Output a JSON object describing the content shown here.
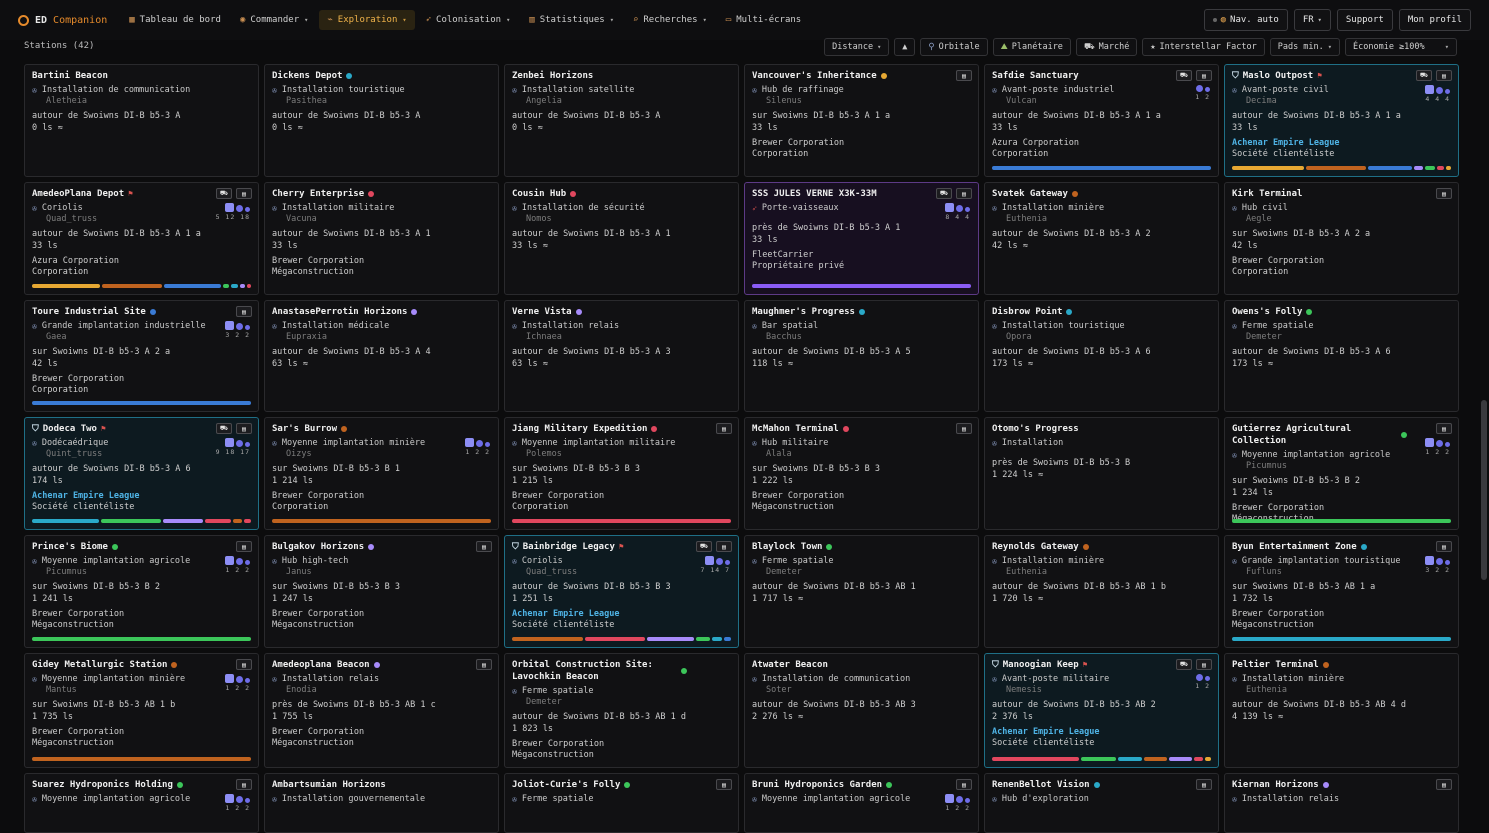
{
  "nav": {
    "brand_ed": "ED",
    "brand_companion": "Companion",
    "items": [
      {
        "label": "Tableau de bord",
        "icon": "dashboard-icon",
        "glyph": "▦",
        "caret": false,
        "active": false
      },
      {
        "label": "Commander",
        "icon": "commander-icon",
        "glyph": "◉",
        "caret": true,
        "active": false
      },
      {
        "label": "Exploration",
        "icon": "telescope-icon",
        "glyph": "⌁",
        "caret": true,
        "active": true
      },
      {
        "label": "Colonisation",
        "icon": "rocket-icon",
        "glyph": "➶",
        "caret": true,
        "active": false
      },
      {
        "label": "Statistiques",
        "icon": "chart-icon",
        "glyph": "▥",
        "caret": true,
        "active": false
      },
      {
        "label": "Recherches",
        "icon": "search-icon",
        "glyph": "⌕",
        "caret": true,
        "active": false
      },
      {
        "label": "Multi-écrans",
        "icon": "monitor-icon",
        "glyph": "▭",
        "caret": false,
        "active": false
      }
    ],
    "nav_auto": "Nav. auto",
    "lang": "FR",
    "support": "Support",
    "profile": "Mon profil"
  },
  "toolbar": {
    "count": "Stations (42)",
    "distance": "Distance",
    "orbitale": "Orbitale",
    "planetaire": "Planétaire",
    "marche": "Marché",
    "interstellar": "Interstellar Factor",
    "pads": "Pads min.",
    "economie": "Économie ≥100%"
  },
  "colors": {
    "orange": "#c0631f",
    "blue": "#3a7bd5",
    "cyan": "#2aa9c8",
    "red": "#e0475e",
    "purple": "#a78bfa",
    "green": "#3cc65a",
    "gold": "#e6a833",
    "violet": "#8b5cf6"
  },
  "stations": [
    {
      "name": "Bartini Beacon",
      "dot": null,
      "type": "Installation de communication",
      "eco": "Aletheia",
      "orbit": "autour de Swoiwns DI-B b5-3 A",
      "dist": "0 ls ≈",
      "fac": "",
      "gov": "",
      "icons": [],
      "pads": null,
      "bar": [],
      "style": ""
    },
    {
      "name": "Dickens Depot",
      "dot": "cyan",
      "type": "Installation touristique",
      "eco": "Pasithea",
      "orbit": "autour de Swoiwns DI-B b5-3 A",
      "dist": "0 ls ≈",
      "fac": "",
      "gov": "",
      "icons": [],
      "pads": null,
      "bar": [],
      "style": ""
    },
    {
      "name": "Zenbei Horizons",
      "dot": null,
      "type": "Installation satellite",
      "eco": "Angelia",
      "orbit": "autour de Swoiwns DI-B b5-3 A",
      "dist": "0 ls ≈",
      "fac": "",
      "gov": "",
      "icons": [],
      "pads": null,
      "bar": [],
      "style": ""
    },
    {
      "name": "Vancouver's Inheritance",
      "dot": "gold",
      "type": "Hub de raffinage",
      "eco": "Silenus",
      "orbit": "sur Swoiwns DI-B b5-3 A 1 a",
      "dist": "33 ls",
      "fac": "Brewer Corporation",
      "gov": "Corporation",
      "icons": [
        "doc"
      ],
      "pads": null,
      "bar": [],
      "style": ""
    },
    {
      "name": "Safdie Sanctuary",
      "dot": null,
      "type": "Avant-poste industriel",
      "eco": "Vulcan",
      "orbit": "autour de Swoiwns DI-B b5-3 A 1 a",
      "dist": "33 ls",
      "fac": "Azura Corporation",
      "gov": "Corporation",
      "icons": [
        "flag",
        "doc"
      ],
      "pads": "12",
      "bar": [
        [
          "blue",
          1
        ]
      ],
      "style": ""
    },
    {
      "name": "Maslo Outpost",
      "dot": null,
      "type": "Avant-poste civil",
      "eco": "Decima",
      "orbit": "autour de Swoiwns DI-B b5-3 A 1 a",
      "dist": "33 ls",
      "fac": "Achenar Empire League",
      "gov": "Société clientéliste",
      "icons": [
        "flag",
        "doc"
      ],
      "pads": "444",
      "bar": [
        [
          "gold",
          3
        ],
        [
          "orange",
          2.5
        ],
        [
          "blue",
          1.8
        ],
        [
          "purple",
          0.4
        ],
        [
          "green",
          0.4
        ],
        [
          "red",
          0.3
        ],
        [
          "gold",
          0.2
        ]
      ],
      "style": "hl"
    },
    {
      "name": "AmedeoPlana Depot",
      "dot": null,
      "type": "Coriolis",
      "eco": "Quad_truss",
      "orbit": "autour de Swoiwns DI-B b5-3 A 1 a",
      "dist": "33 ls",
      "fac": "Azura Corporation",
      "gov": "Corporation",
      "icons": [
        "flag",
        "doc"
      ],
      "pads": "51218",
      "bar": [
        [
          "gold",
          3
        ],
        [
          "orange",
          2.7
        ],
        [
          "blue",
          2.5
        ],
        [
          "green",
          0.3
        ],
        [
          "cyan",
          0.3
        ],
        [
          "purple",
          0.2
        ],
        [
          "red",
          0.2
        ]
      ],
      "style": ""
    },
    {
      "name": "Cherry Enterprise",
      "dot": "red",
      "type": "Installation militaire",
      "eco": "Vacuna",
      "orbit": "autour de Swoiwns DI-B b5-3 A 1",
      "dist": "33 ls",
      "fac": "Brewer Corporation",
      "gov": "Mégaconstruction",
      "icons": [],
      "pads": null,
      "bar": [],
      "style": ""
    },
    {
      "name": "Cousin Hub",
      "dot": "red",
      "type": "Installation de sécurité",
      "eco": "Nomos",
      "orbit": "autour de Swoiwns DI-B b5-3 A 1",
      "dist": "33 ls ≈",
      "fac": "",
      "gov": "",
      "icons": [],
      "pads": null,
      "bar": [],
      "style": ""
    },
    {
      "name": "SSS JULES VERNE X3K-33M",
      "dot": null,
      "type": "Porte-vaisseaux",
      "eco": "",
      "orbit": "près de Swoiwns DI-B b5-3 A 1",
      "dist": "33 ls",
      "fac": "FleetCarrier",
      "gov": "Propriétaire privé",
      "icons": [
        "flag",
        "doc"
      ],
      "pads": "844",
      "bar": [
        [
          "violet",
          1
        ]
      ],
      "style": "fleet"
    },
    {
      "name": "Svatek Gateway",
      "dot": "orange",
      "type": "Installation minière",
      "eco": "Euthenia",
      "orbit": "autour de Swoiwns DI-B b5-3 A 2",
      "dist": "42 ls ≈",
      "fac": "",
      "gov": "",
      "icons": [],
      "pads": null,
      "bar": [],
      "style": ""
    },
    {
      "name": "Kirk Terminal",
      "dot": null,
      "type": "Hub civil",
      "eco": "Aegle",
      "orbit": "sur Swoiwns DI-B b5-3 A 2 a",
      "dist": "42 ls",
      "fac": "Brewer Corporation",
      "gov": "Corporation",
      "icons": [
        "doc"
      ],
      "pads": null,
      "bar": [],
      "style": ""
    },
    {
      "name": "Toure Industrial Site",
      "dot": "blue",
      "type": "Grande implantation industrielle",
      "eco": "Gaea",
      "orbit": "sur Swoiwns DI-B b5-3 A 2 a",
      "dist": "42 ls",
      "fac": "Brewer Corporation",
      "gov": "Corporation",
      "icons": [
        "doc"
      ],
      "pads": "322",
      "bar": [
        [
          "blue",
          1
        ]
      ],
      "style": ""
    },
    {
      "name": "AnastasePerrotin Horizons",
      "dot": "purple",
      "type": "Installation médicale",
      "eco": "Eupraxia",
      "orbit": "autour de Swoiwns DI-B b5-3 A 4",
      "dist": "63 ls ≈",
      "fac": "",
      "gov": "",
      "icons": [],
      "pads": null,
      "bar": [],
      "style": ""
    },
    {
      "name": "Verne Vista",
      "dot": "purple",
      "type": "Installation relais",
      "eco": "Ichnaea",
      "orbit": "autour de Swoiwns DI-B b5-3 A 3",
      "dist": "63 ls ≈",
      "fac": "",
      "gov": "",
      "icons": [],
      "pads": null,
      "bar": [],
      "style": ""
    },
    {
      "name": "Maughmer's Progress",
      "dot": "cyan",
      "type": "Bar spatial",
      "eco": "Bacchus",
      "orbit": "autour de Swoiwns DI-B b5-3 A 5",
      "dist": "118 ls ≈",
      "fac": "",
      "gov": "",
      "icons": [],
      "pads": null,
      "bar": [],
      "style": ""
    },
    {
      "name": "Disbrow Point",
      "dot": "cyan",
      "type": "Installation touristique",
      "eco": "Opora",
      "orbit": "autour de Swoiwns DI-B b5-3 A 6",
      "dist": "173 ls ≈",
      "fac": "",
      "gov": "",
      "icons": [],
      "pads": null,
      "bar": [],
      "style": ""
    },
    {
      "name": "Owens's Folly",
      "dot": "green",
      "type": "Ferme spatiale",
      "eco": "Demeter",
      "orbit": "autour de Swoiwns DI-B b5-3 A 6",
      "dist": "173 ls ≈",
      "fac": "",
      "gov": "",
      "icons": [],
      "pads": null,
      "bar": [],
      "style": ""
    },
    {
      "name": "Dodeca Two",
      "dot": null,
      "type": "Dodécaédrique",
      "eco": "Quint_truss",
      "orbit": "autour de Swoiwns DI-B b5-3 A 6",
      "dist": "174 ls",
      "fac": "Achenar Empire League",
      "gov": "Société clientéliste",
      "icons": [
        "flag",
        "doc"
      ],
      "pads": "91817",
      "bar": [
        [
          "cyan",
          3
        ],
        [
          "green",
          2.7
        ],
        [
          "purple",
          1.8
        ],
        [
          "red",
          1.2
        ],
        [
          "orange",
          0.4
        ],
        [
          "red",
          0.3
        ]
      ],
      "style": "hl"
    },
    {
      "name": "Sar's Burrow",
      "dot": "orange",
      "type": "Moyenne implantation minière",
      "eco": "Oizys",
      "orbit": "sur Swoiwns DI-B b5-3 B 1",
      "dist": "1 214 ls",
      "fac": "Brewer Corporation",
      "gov": "Corporation",
      "icons": [],
      "pads": "122",
      "bar": [
        [
          "orange",
          1
        ]
      ],
      "style": ""
    },
    {
      "name": "Jiang Military Expedition",
      "dot": "red",
      "type": "Moyenne implantation militaire",
      "eco": "Polemos",
      "orbit": "sur Swoiwns DI-B b5-3 B 3",
      "dist": "1 215 ls",
      "fac": "Brewer Corporation",
      "gov": "Corporation",
      "icons": [
        "doc"
      ],
      "pads": null,
      "bar": [
        [
          "red",
          1
        ]
      ],
      "style": ""
    },
    {
      "name": "McMahon Terminal",
      "dot": "red",
      "type": "Hub militaire",
      "eco": "Alala",
      "orbit": "sur Swoiwns DI-B b5-3 B 3",
      "dist": "1 222 ls",
      "fac": "Brewer Corporation",
      "gov": "Mégaconstruction",
      "icons": [
        "doc"
      ],
      "pads": null,
      "bar": [],
      "style": ""
    },
    {
      "name": "Otomo's Progress",
      "dot": null,
      "type": "Installation",
      "eco": "",
      "orbit": "près de Swoiwns DI-B b5-3 B",
      "dist": "1 224 ls ≈",
      "fac": "",
      "gov": "",
      "icons": [],
      "pads": null,
      "bar": [],
      "style": ""
    },
    {
      "name": "Gutierrez Agricultural Collection",
      "dot": "green",
      "type": "Moyenne implantation agricole",
      "eco": "Picumnus",
      "orbit": "sur Swoiwns DI-B b5-3 B 2",
      "dist": "1 234 ls",
      "fac": "Brewer Corporation",
      "gov": "Mégaconstruction",
      "icons": [
        "doc"
      ],
      "pads": "122",
      "bar": [
        [
          "green",
          1
        ]
      ],
      "style": ""
    },
    {
      "name": "Prince's Biome",
      "dot": "green",
      "type": "Moyenne implantation agricole",
      "eco": "Picumnus",
      "orbit": "sur Swoiwns DI-B b5-3 B 2",
      "dist": "1 241 ls",
      "fac": "Brewer Corporation",
      "gov": "Mégaconstruction",
      "icons": [
        "doc"
      ],
      "pads": "122",
      "bar": [
        [
          "green",
          1
        ]
      ],
      "style": ""
    },
    {
      "name": "Bulgakov Horizons",
      "dot": "purple",
      "type": "Hub high-tech",
      "eco": "Janus",
      "orbit": "sur Swoiwns DI-B b5-3 B 3",
      "dist": "1 247 ls",
      "fac": "Brewer Corporation",
      "gov": "Mégaconstruction",
      "icons": [
        "doc"
      ],
      "pads": null,
      "bar": [],
      "style": ""
    },
    {
      "name": "Bainbridge Legacy",
      "dot": null,
      "type": "Coriolis",
      "eco": "Quad_truss",
      "orbit": "autour de Swoiwns DI-B b5-3 B 3",
      "dist": "1 251 ls",
      "fac": "Achenar Empire League",
      "gov": "Société clientéliste",
      "icons": [
        "flag",
        "doc"
      ],
      "pads": "7147",
      "bar": [
        [
          "orange",
          3
        ],
        [
          "red",
          2.5
        ],
        [
          "purple",
          2
        ],
        [
          "green",
          0.6
        ],
        [
          "cyan",
          0.4
        ],
        [
          "blue",
          0.3
        ]
      ],
      "style": "hl"
    },
    {
      "name": "Blaylock Town",
      "dot": "green",
      "type": "Ferme spatiale",
      "eco": "Demeter",
      "orbit": "autour de Swoiwns DI-B b5-3 AB 1",
      "dist": "1 717 ls ≈",
      "fac": "",
      "gov": "",
      "icons": [],
      "pads": null,
      "bar": [],
      "style": ""
    },
    {
      "name": "Reynolds Gateway",
      "dot": "orange",
      "type": "Installation minière",
      "eco": "Euthenia",
      "orbit": "autour de Swoiwns DI-B b5-3 AB 1 b",
      "dist": "1 720 ls ≈",
      "fac": "",
      "gov": "",
      "icons": [],
      "pads": null,
      "bar": [],
      "style": ""
    },
    {
      "name": "Byun Entertainment Zone",
      "dot": "cyan",
      "type": "Grande implantation touristique",
      "eco": "Fufluns",
      "orbit": "sur Swoiwns DI-B b5-3 AB 1 a",
      "dist": "1 732 ls",
      "fac": "Brewer Corporation",
      "gov": "Mégaconstruction",
      "icons": [
        "doc"
      ],
      "pads": "322",
      "bar": [
        [
          "cyan",
          1
        ]
      ],
      "style": ""
    },
    {
      "name": "Gidey Metallurgic Station",
      "dot": "orange",
      "type": "Moyenne implantation minière",
      "eco": "Mantus",
      "orbit": "sur Swoiwns DI-B b5-3 AB 1 b",
      "dist": "1 735 ls",
      "fac": "Brewer Corporation",
      "gov": "Mégaconstruction",
      "icons": [
        "doc"
      ],
      "pads": "122",
      "bar": [
        [
          "orange",
          1
        ]
      ],
      "style": ""
    },
    {
      "name": "Amedeoplana Beacon",
      "dot": "purple",
      "type": "Installation relais",
      "eco": "Enodia",
      "orbit": "près de Swoiwns DI-B b5-3 AB 1 c",
      "dist": "1 755 ls",
      "fac": "Brewer Corporation",
      "gov": "Mégaconstruction",
      "icons": [
        "doc"
      ],
      "pads": null,
      "bar": [],
      "style": ""
    },
    {
      "name": "Orbital Construction Site: Lavochkin Beacon",
      "dot": "green",
      "type": "Ferme spatiale",
      "eco": "Demeter",
      "orbit": "autour de Swoiwns DI-B b5-3 AB 1 d",
      "dist": "1 823 ls",
      "fac": "Brewer Corporation",
      "gov": "Mégaconstruction",
      "icons": [],
      "pads": null,
      "bar": [],
      "style": ""
    },
    {
      "name": "Atwater Beacon",
      "dot": null,
      "type": "Installation de communication",
      "eco": "Soter",
      "orbit": "autour de Swoiwns DI-B b5-3 AB 3",
      "dist": "2 276 ls ≈",
      "fac": "",
      "gov": "",
      "icons": [],
      "pads": null,
      "bar": [],
      "style": ""
    },
    {
      "name": "Manoogian Keep",
      "dot": null,
      "type": "Avant-poste militaire",
      "eco": "Nemesis",
      "orbit": "autour de Swoiwns DI-B b5-3 AB 2",
      "dist": "2 376 ls",
      "fac": "Achenar Empire League",
      "gov": "Société clientéliste",
      "icons": [
        "flag",
        "doc"
      ],
      "pads": "12",
      "bar": [
        [
          "red",
          3
        ],
        [
          "green",
          1.2
        ],
        [
          "cyan",
          0.8
        ],
        [
          "orange",
          0.8
        ],
        [
          "purple",
          0.8
        ],
        [
          "red",
          0.3
        ],
        [
          "gold",
          0.2
        ]
      ],
      "style": "hl"
    },
    {
      "name": "Peltier Terminal",
      "dot": "orange",
      "type": "Installation minière",
      "eco": "Euthenia",
      "orbit": "autour de Swoiwns DI-B b5-3 AB 4 d",
      "dist": "4 139 ls ≈",
      "fac": "",
      "gov": "",
      "icons": [],
      "pads": null,
      "bar": [],
      "style": ""
    },
    {
      "name": "Suarez Hydroponics Holding",
      "dot": "green",
      "type": "Moyenne implantation agricole",
      "eco": "",
      "orbit": "",
      "dist": "",
      "fac": "",
      "gov": "",
      "icons": [
        "doc"
      ],
      "pads": "122",
      "bar": [],
      "style": ""
    },
    {
      "name": "Ambartsumian Horizons",
      "dot": null,
      "type": "Installation gouvernementale",
      "eco": "",
      "orbit": "",
      "dist": "",
      "fac": "",
      "gov": "",
      "icons": [],
      "pads": null,
      "bar": [],
      "style": ""
    },
    {
      "name": "Joliot-Curie's Folly",
      "dot": "green",
      "type": "Ferme spatiale",
      "eco": "",
      "orbit": "",
      "dist": "",
      "fac": "",
      "gov": "",
      "icons": [
        "doc"
      ],
      "pads": null,
      "bar": [],
      "style": ""
    },
    {
      "name": "Bruni Hydroponics Garden",
      "dot": "green",
      "type": "Moyenne implantation agricole",
      "eco": "",
      "orbit": "",
      "dist": "",
      "fac": "",
      "gov": "",
      "icons": [
        "doc"
      ],
      "pads": "122",
      "bar": [],
      "style": ""
    },
    {
      "name": "RenenBellot Vision",
      "dot": "cyan",
      "type": "Hub d'exploration",
      "eco": "",
      "orbit": "",
      "dist": "",
      "fac": "",
      "gov": "",
      "icons": [
        "doc"
      ],
      "pads": null,
      "bar": [],
      "style": ""
    },
    {
      "name": "Kiernan Horizons",
      "dot": "purple",
      "type": "Installation relais",
      "eco": "",
      "orbit": "",
      "dist": "",
      "fac": "",
      "gov": "",
      "icons": [
        "doc"
      ],
      "pads": null,
      "bar": [],
      "style": ""
    }
  ]
}
